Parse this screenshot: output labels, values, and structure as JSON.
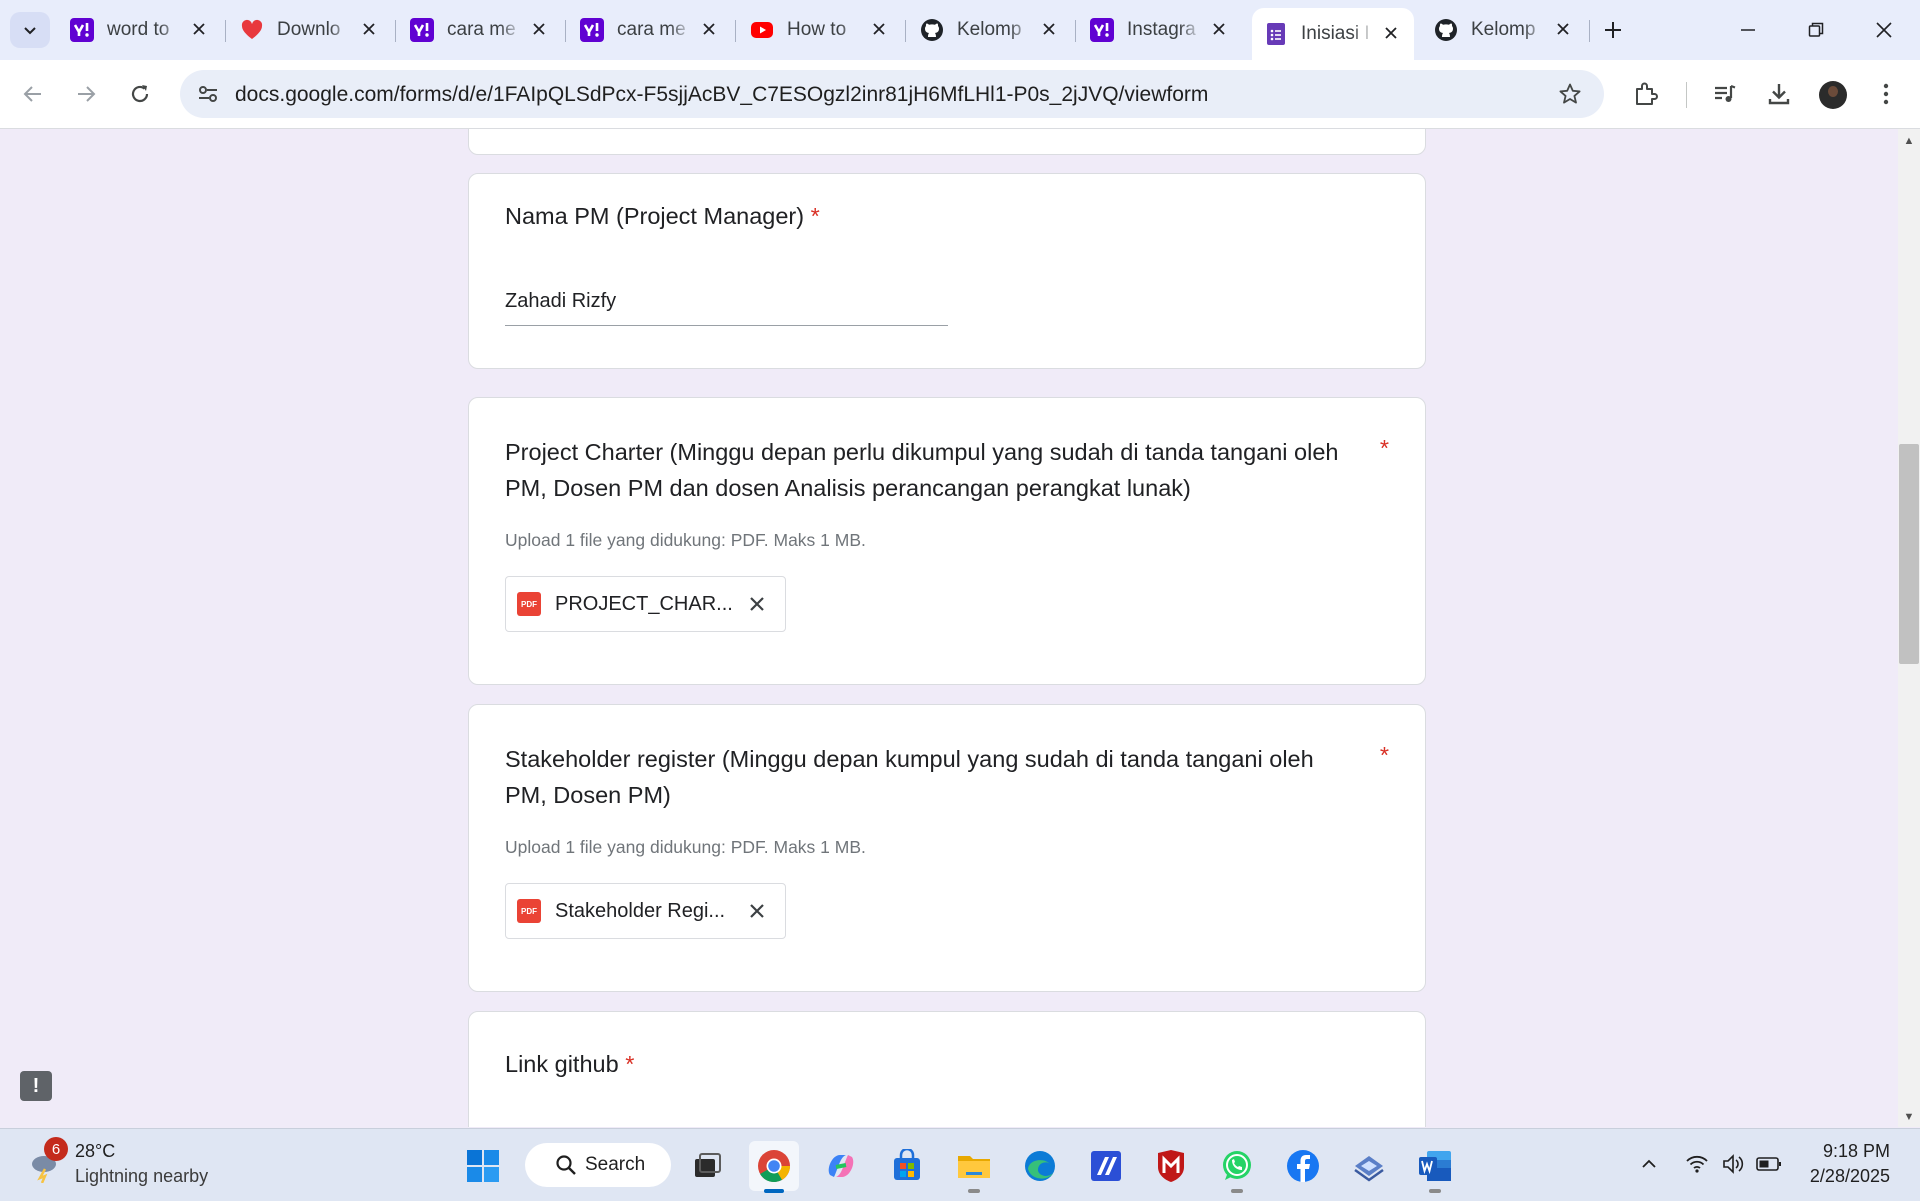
{
  "browser": {
    "tabs": [
      {
        "title": "word to",
        "favicon": "yahoo",
        "color": "#6001d2",
        "active": false
      },
      {
        "title": "Downlo",
        "favicon": "heart",
        "color": "#e8383d",
        "active": false
      },
      {
        "title": "cara me",
        "favicon": "yahoo",
        "color": "#6001d2",
        "active": false
      },
      {
        "title": "cara me",
        "favicon": "yahoo",
        "color": "#6001d2",
        "active": false
      },
      {
        "title": "How to",
        "favicon": "youtube",
        "color": "#ff0000",
        "active": false
      },
      {
        "title": "Kelomp",
        "favicon": "github",
        "color": "#1f2328",
        "active": false
      },
      {
        "title": "Instagra",
        "favicon": "yahoo",
        "color": "#6001d2",
        "active": false
      },
      {
        "title": "Inisiasi I",
        "favicon": "forms",
        "color": "#673ab7",
        "active": true
      },
      {
        "title": "Kelomp",
        "favicon": "github",
        "color": "#1f2328",
        "active": false
      }
    ],
    "url": "docs.google.com/forms/d/e/1FAIpQLSdPcx-F5sjjAcBV_C7ESOgzl2inr81jH6MfLHl1-P0s_2jJVQ/viewform"
  },
  "form": {
    "questions": [
      {
        "title": "Nama PM (Project Manager)",
        "required_mark": "*",
        "answer": "Zahadi Rizfy"
      },
      {
        "title_line1": "Project Charter  (Minggu depan perlu dikumpul yang sudah di tanda tangani oleh",
        "title_line2": "PM, Dosen PM dan dosen Analisis perancangan perangkat lunak)",
        "required_mark": "*",
        "hint": "Upload 1 file yang didukung: PDF. Maks 1 MB.",
        "file_name": "PROJECT_CHAR...",
        "file_type": "PDF"
      },
      {
        "title_line1": "Stakeholder register (Minggu depan kumpul yang sudah di tanda tangani oleh",
        "title_line2": "PM, Dosen PM)",
        "required_mark": "*",
        "hint": "Upload 1 file yang didukung: PDF. Maks 1 MB.",
        "file_name": "Stakeholder Regi...",
        "file_type": "PDF"
      },
      {
        "title": "Link github",
        "required_mark": "*"
      }
    ],
    "feedback_glyph": "!"
  },
  "taskbar": {
    "weather": {
      "badge": "6",
      "temp": "28°C",
      "desc": "Lightning nearby"
    },
    "search_label": "Search",
    "clock": {
      "time": "9:18 PM",
      "date": "2/28/2025"
    }
  }
}
